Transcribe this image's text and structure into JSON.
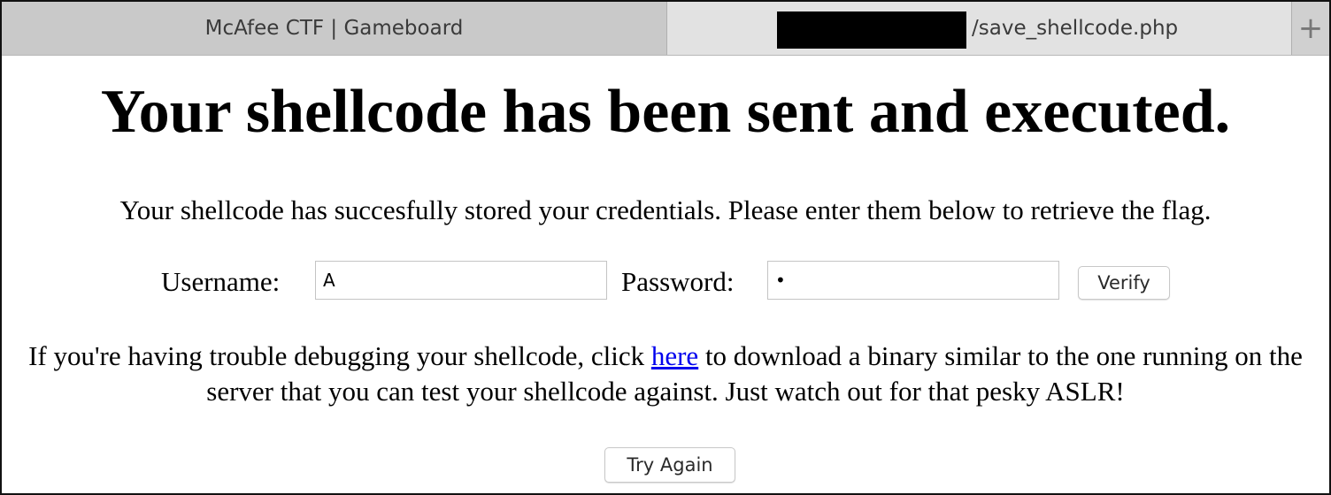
{
  "tabs": [
    {
      "title": "McAfee CTF | Gameboard"
    },
    {
      "title": "/save_shellcode.php"
    }
  ],
  "new_tab_symbol": "+",
  "page": {
    "heading": "Your shellcode has been sent and executed.",
    "message": "Your shellcode has succesfully stored your credentials. Please enter them below to retrieve the flag.",
    "username_label": "Username:",
    "username_value": "A",
    "password_label": "Password:",
    "password_value": "•",
    "verify_label": "Verify",
    "debug_text_before": "If you're having trouble debugging your shellcode, click ",
    "debug_link": "here",
    "debug_text_after": " to download a binary similar to the one running on the server that you can test your shellcode against. Just watch out for that pesky ASLR!",
    "try_again_label": "Try Again"
  },
  "colors": {
    "link": "#0000ee",
    "tabbar": "#d6d6d6",
    "redaction": "#000000"
  }
}
